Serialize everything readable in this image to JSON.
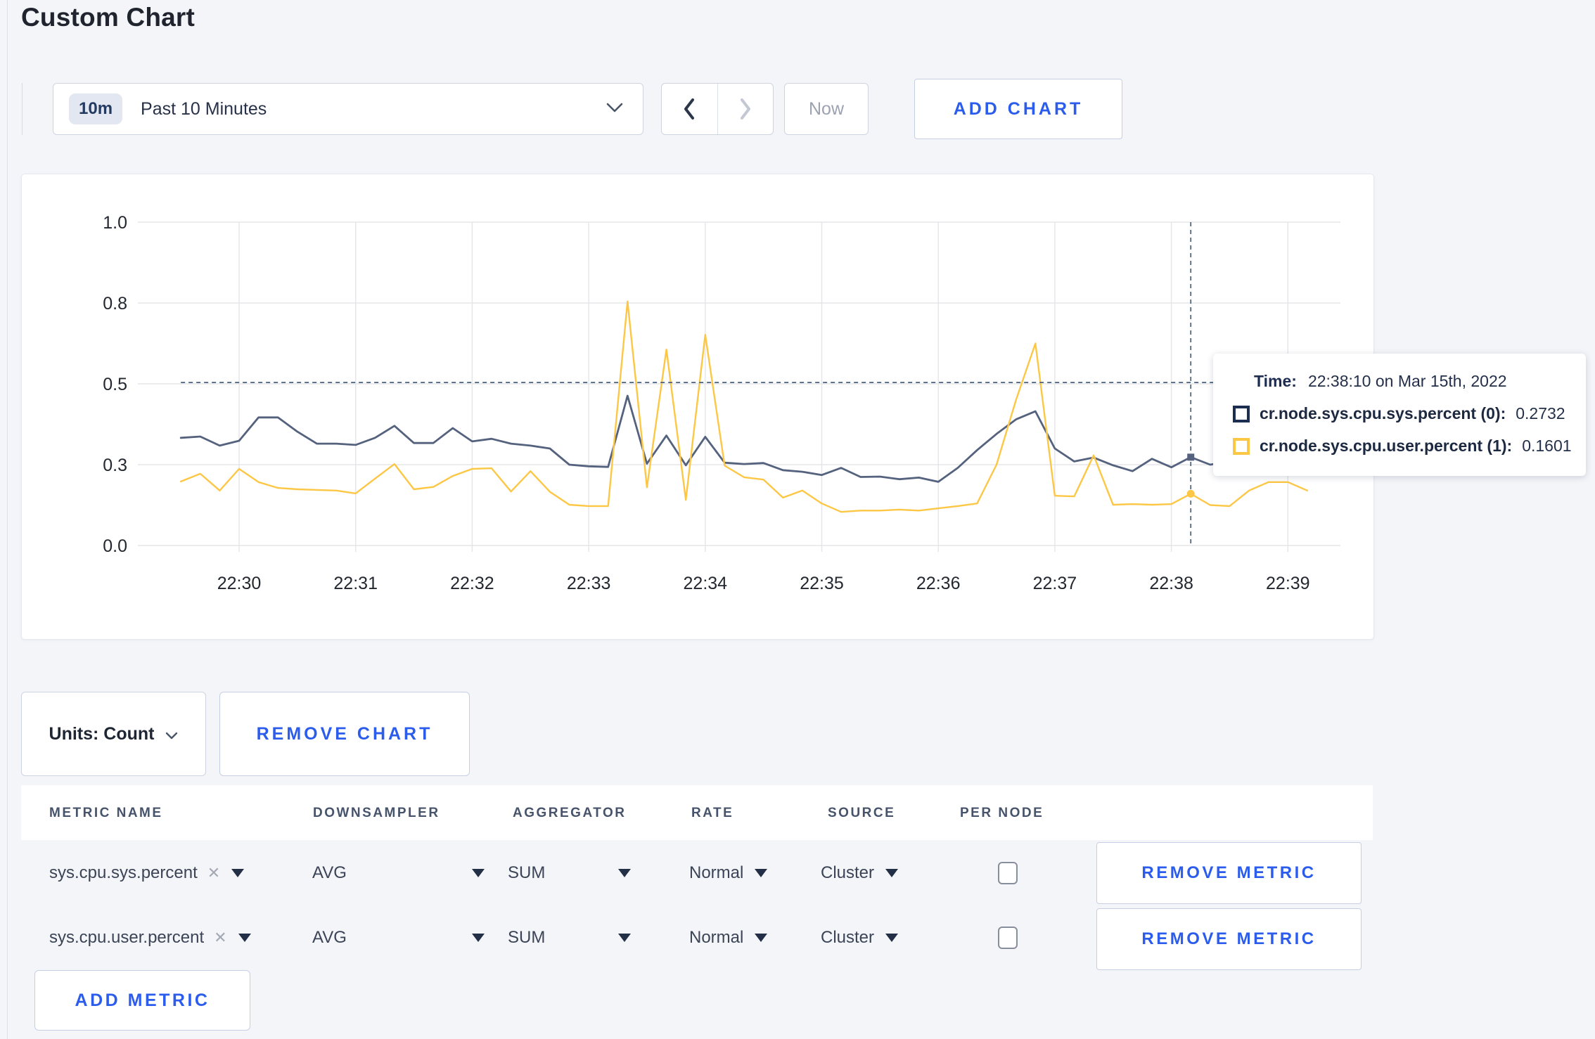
{
  "page": {
    "title": "Custom Chart"
  },
  "colors": {
    "accent_blue": "#2b5cec",
    "sys_series": "#54627e",
    "user_series": "#fdc746",
    "tooltip_sys_marker": "#1b2e4f",
    "tooltip_user_marker": "#fdc746",
    "gridline": "#e5e5e9",
    "crosshair": "#46627e"
  },
  "icons": {
    "chevron_left": "prev-range",
    "chevron_right": "next-range",
    "chevron_down": "open-dropdown",
    "remove_x": "✕",
    "dropdown_triangle": "select-arrow"
  },
  "toolbar": {
    "badge": "10m",
    "range_label": "Past 10 Minutes",
    "now_label": "Now",
    "add_chart_label": "ADD CHART"
  },
  "chart_data": {
    "type": "line",
    "title": "",
    "xlabel": "",
    "ylabel": "",
    "grid": true,
    "y_axis": {
      "range": [
        0,
        1
      ],
      "tick_positions": [
        0,
        0.25,
        0.5,
        0.75,
        1.0
      ],
      "tick_labels": [
        "0.0",
        "0.3",
        "0.5",
        "0.8",
        "1.0"
      ]
    },
    "x_axis": {
      "tick_seconds": [
        0,
        60,
        120,
        180,
        240,
        300,
        360,
        420,
        480,
        540
      ],
      "tick_labels": [
        "22:30",
        "22:31",
        "22:32",
        "22:33",
        "22:34",
        "22:35",
        "22:36",
        "22:37",
        "22:38",
        "22:39"
      ]
    },
    "t_start_seconds": -30,
    "t_step_seconds": 10,
    "series": [
      {
        "name": "cr.node.sys.cpu.sys.percent",
        "values": [
          0.333,
          0.337,
          0.309,
          0.324,
          0.396,
          0.396,
          0.352,
          0.315,
          0.315,
          0.311,
          0.333,
          0.37,
          0.317,
          0.317,
          0.363,
          0.322,
          0.33,
          0.315,
          0.309,
          0.3,
          0.25,
          0.245,
          0.243,
          0.463,
          0.253,
          0.34,
          0.248,
          0.336,
          0.256,
          0.252,
          0.255,
          0.233,
          0.228,
          0.218,
          0.24,
          0.212,
          0.213,
          0.205,
          0.21,
          0.197,
          0.24,
          0.295,
          0.345,
          0.39,
          0.415,
          0.3,
          0.26,
          0.272,
          0.248,
          0.23,
          0.268,
          0.242,
          0.2732,
          0.25,
          0.26,
          0.24,
          0.25,
          0.25,
          0.248
        ]
      },
      {
        "name": "cr.node.sys.cpu.user.percent",
        "values": [
          0.198,
          0.222,
          0.17,
          0.237,
          0.196,
          0.178,
          0.174,
          0.172,
          0.17,
          0.161,
          0.207,
          0.252,
          0.174,
          0.181,
          0.215,
          0.237,
          0.239,
          0.167,
          0.23,
          0.166,
          0.126,
          0.122,
          0.122,
          0.755,
          0.18,
          0.606,
          0.141,
          0.652,
          0.247,
          0.211,
          0.204,
          0.148,
          0.17,
          0.13,
          0.104,
          0.108,
          0.108,
          0.111,
          0.108,
          0.115,
          0.122,
          0.13,
          0.25,
          0.45,
          0.625,
          0.154,
          0.152,
          0.279,
          0.126,
          0.128,
          0.126,
          0.128,
          0.1601,
          0.125,
          0.122,
          0.17,
          0.196,
          0.196,
          0.17
        ]
      }
    ],
    "crosshair": {
      "t_seconds": 490,
      "cursor_value": 0.504,
      "sys_value": 0.2732,
      "user_value": 0.1601
    }
  },
  "tooltip": {
    "time_label": "Time:",
    "time_value": "22:38:10 on Mar 15th, 2022",
    "series": [
      {
        "name": "cr.node.sys.cpu.sys.percent (0):",
        "value": "0.2732"
      },
      {
        "name": "cr.node.sys.cpu.user.percent (1):",
        "value": "0.1601"
      }
    ]
  },
  "chart_controls": {
    "units_label": "Units: Count",
    "remove_chart_label": "REMOVE CHART"
  },
  "metrics_table": {
    "headers": [
      "METRIC NAME",
      "DOWNSAMPLER",
      "AGGREGATOR",
      "RATE",
      "SOURCE",
      "PER NODE"
    ],
    "rows": [
      {
        "metric_name": "sys.cpu.sys.percent",
        "downsampler": "AVG",
        "aggregator": "SUM",
        "rate": "Normal",
        "source": "Cluster",
        "per_node_checked": false,
        "remove_label": "REMOVE METRIC"
      },
      {
        "metric_name": "sys.cpu.user.percent",
        "downsampler": "AVG",
        "aggregator": "SUM",
        "rate": "Normal",
        "source": "Cluster",
        "per_node_checked": false,
        "remove_label": "REMOVE METRIC"
      }
    ],
    "add_metric_label": "ADD METRIC"
  }
}
